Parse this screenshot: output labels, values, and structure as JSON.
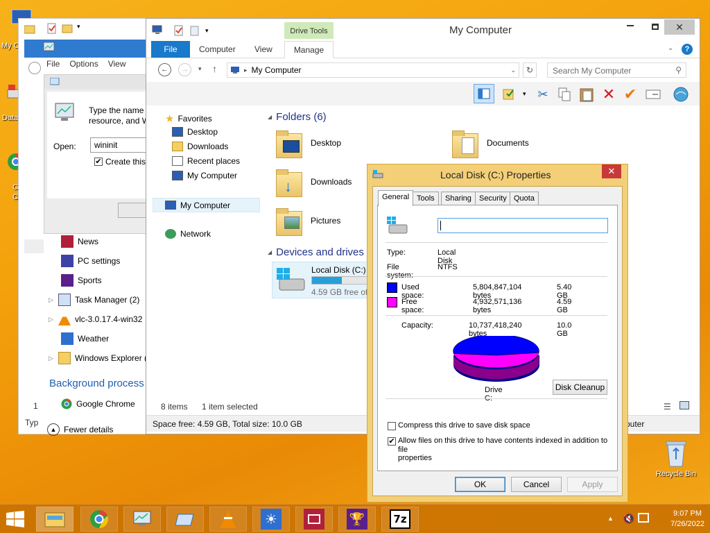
{
  "desktop": {
    "left_labels": [
      "My C",
      "Data",
      "G",
      "C"
    ],
    "recycle_bin": "Recycle Bin"
  },
  "run_dialog": {
    "menu": [
      "File",
      "Options",
      "View"
    ],
    "prompt": "Type the name",
    "prompt2": "resource, and W",
    "open_label": "Open:",
    "open_value": "wininit",
    "create_label": "Create this"
  },
  "task_manager": {
    "items": [
      "News",
      "PC settings",
      "Sports",
      "Task Manager (2)",
      "vlc-3.0.17.4-win32",
      "Weather",
      "Windows Explorer ("
    ],
    "section": "Background process",
    "chrome": "Google Chrome",
    "fewer": "Fewer details",
    "left_col": [
      "1",
      "Typ"
    ]
  },
  "explorer": {
    "title": "My Computer",
    "drive_tools": "Drive Tools",
    "tabs": [
      "File",
      "Computer",
      "View",
      "Manage"
    ],
    "address": "My Computer",
    "search_placeholder": "Search My Computer",
    "nav": {
      "favorites": "Favorites",
      "desktop": "Desktop",
      "downloads": "Downloads",
      "recent": "Recent places",
      "mycomp": "My Computer",
      "mycomp2": "My Computer",
      "network": "Network"
    },
    "folders_header": "Folders (6)",
    "folders": [
      "Desktop",
      "Documents",
      "Downloads",
      "Pictures"
    ],
    "devices_header": "Devices and drives (",
    "drive": {
      "name": "Local Disk (C:)",
      "free": "4.59 GB free of",
      "used_fraction": 0.54
    },
    "status_items": "8 items",
    "status_selected": "1 item selected",
    "statusbar": "Space free: 4.59 GB, Total size: 10.0 GB",
    "statusbar_right": "puter"
  },
  "properties": {
    "title": "Local Disk (C:) Properties",
    "tabs": [
      "General",
      "Tools",
      "Sharing",
      "Security",
      "Quota"
    ],
    "name_value": "",
    "type_label": "Type:",
    "type_value": "Local Disk",
    "fs_label": "File system:",
    "fs_value": "NTFS",
    "used_label": "Used space:",
    "used_bytes": "5,804,847,104 bytes",
    "used_gb": "5.40 GB",
    "free_label": "Free space:",
    "free_bytes": "4,932,571,136 bytes",
    "free_gb": "4.59 GB",
    "cap_label": "Capacity:",
    "cap_bytes": "10,737,418,240 bytes",
    "cap_gb": "10.0 GB",
    "drive_label": "Drive C:",
    "cleanup": "Disk Cleanup",
    "compress": "Compress this drive to save disk space",
    "index": "Allow files on this drive to have contents indexed in addition to",
    "index2": "file properties",
    "ok": "OK",
    "cancel": "Cancel",
    "apply": "Apply",
    "colors": {
      "used": "#0000ff",
      "free": "#ff00ff"
    }
  },
  "clock": {
    "time": "9:07 PM",
    "date": "7/26/2022"
  }
}
